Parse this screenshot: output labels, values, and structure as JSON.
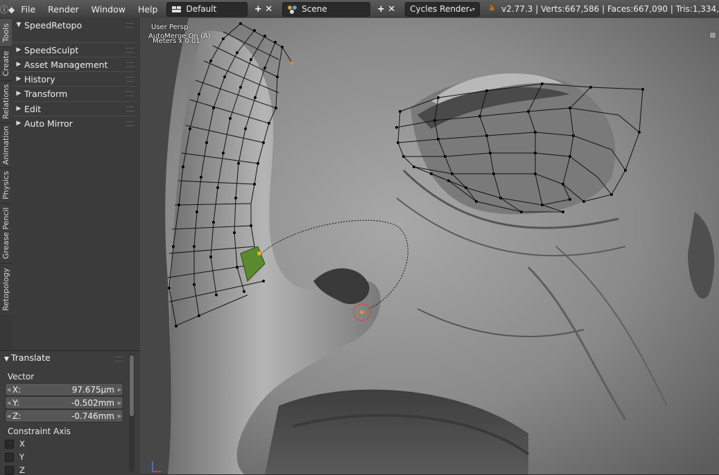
{
  "header": {
    "info_icon": "info-icon",
    "menus": [
      "File",
      "Render",
      "Window",
      "Help"
    ],
    "layout_value": "Default",
    "scene_value": "Scene",
    "render_engine": "Cycles Render",
    "stats": "v2.77.3 | Verts:667,586 | Faces:667,090 | Tris:1,334,"
  },
  "tabs": [
    "Tools",
    "Create",
    "Relations",
    "Animation",
    "Physics",
    "Grease Pencil",
    "Retopology"
  ],
  "panels": [
    {
      "label": "SpeedRetopo",
      "expanded": true
    },
    {
      "label": "SpeedSculpt",
      "expanded": false
    },
    {
      "label": "Asset Management",
      "expanded": false
    },
    {
      "label": "History",
      "expanded": false
    },
    {
      "label": "Transform",
      "expanded": false
    },
    {
      "label": "Edit",
      "expanded": false
    },
    {
      "label": "Auto Mirror",
      "expanded": false
    }
  ],
  "operator": {
    "title": "Translate",
    "vector_label": "Vector",
    "x_label": "X:",
    "x_value": "97.675µm",
    "y_label": "Y:",
    "y_value": "-0.502mm",
    "z_label": "Z:",
    "z_value": "-0.746mm",
    "constraint_label": "Constraint Axis",
    "axis_x": "X",
    "axis_y": "Y",
    "axis_z": "Z"
  },
  "viewport": {
    "view_name": "User Persp",
    "automerge": "AutoMerge On (A)",
    "units": "Meters x 0.01"
  },
  "colors": {
    "accent": "#e87d0d",
    "selected_face": "#5a8a2e",
    "mesh_wire": "#111111"
  }
}
